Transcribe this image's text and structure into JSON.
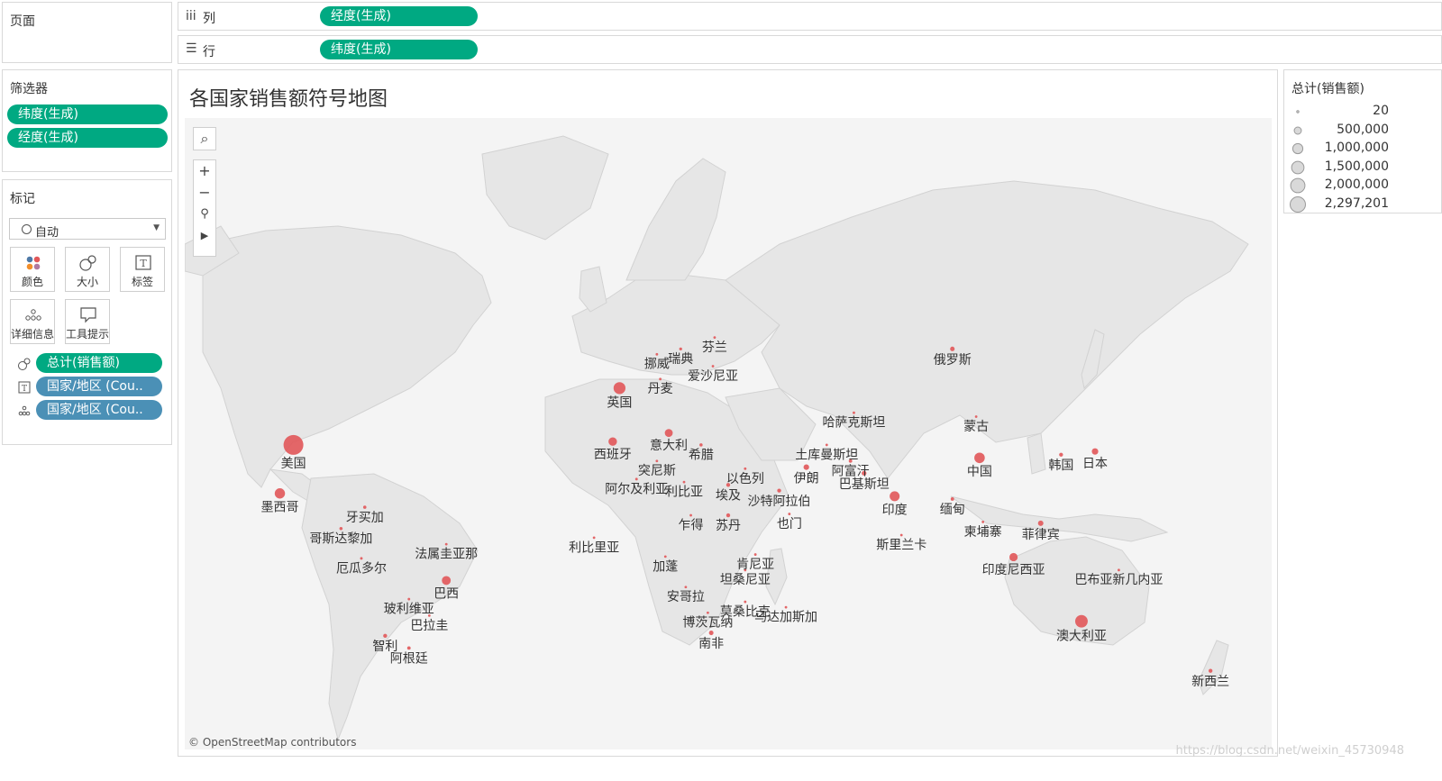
{
  "shelves": {
    "pages_label": "页面",
    "columns_icon": "iii",
    "columns_label": "列",
    "columns_pill": "经度(生成)",
    "rows_icon": "☰",
    "rows_label": "行",
    "rows_pill": "纬度(生成)"
  },
  "filters": {
    "title": "筛选器",
    "items": [
      "纬度(生成)",
      "经度(生成)"
    ]
  },
  "marks": {
    "title": "标记",
    "mark_type": "自动",
    "buttons": [
      "颜色",
      "大小",
      "标签",
      "详细信息",
      "工具提示"
    ],
    "fields": [
      "总计(销售额)",
      "国家/地区 (Cou..",
      "国家/地区 (Cou.."
    ]
  },
  "sheet": {
    "title": "各国家销售额符号地图"
  },
  "map": {
    "copyright": "© OpenStreetMap contributors",
    "marker_color": "#e15759",
    "land_color": "#e6e6e6",
    "water_color": "#f4f4f4"
  },
  "chart_data": {
    "type": "symbol-map",
    "title": "各国家销售额符号地图",
    "size_field": "总计(销售额)",
    "countries": [
      {
        "name": "美国",
        "lon": -98,
        "lat": 39,
        "size": 2297201
      },
      {
        "name": "墨西哥",
        "lon": -102,
        "lat": 23,
        "size": 620000
      },
      {
        "name": "牙买加",
        "lon": -77,
        "lat": 18,
        "size": 60000
      },
      {
        "name": "哥斯达黎加",
        "lon": -84,
        "lat": 10,
        "size": 60000
      },
      {
        "name": "法属圭亚那",
        "lon": -53,
        "lat": 4,
        "size": 20
      },
      {
        "name": "厄瓜多尔",
        "lon": -78,
        "lat": -1.5,
        "size": 40000
      },
      {
        "name": "巴西",
        "lon": -53,
        "lat": -10,
        "size": 460000
      },
      {
        "name": "玻利维亚",
        "lon": -64,
        "lat": -17,
        "size": 20000
      },
      {
        "name": "智利",
        "lon": -71,
        "lat": -30,
        "size": 90000
      },
      {
        "name": "巴拉圭",
        "lon": -58,
        "lat": -23,
        "size": 20000
      },
      {
        "name": "阿根廷",
        "lon": -64,
        "lat": -34,
        "size": 70000
      },
      {
        "name": "英国",
        "lon": -2,
        "lat": 54,
        "size": 830000
      },
      {
        "name": "丹麦",
        "lon": 10,
        "lat": 56,
        "size": 20000
      },
      {
        "name": "瑞典",
        "lon": 16,
        "lat": 62,
        "size": 50000
      },
      {
        "name": "挪威",
        "lon": 9,
        "lat": 61,
        "size": 30000
      },
      {
        "name": "芬兰",
        "lon": 26,
        "lat": 64,
        "size": 30000
      },
      {
        "name": "爱沙尼亚",
        "lon": 25.5,
        "lat": 58.7,
        "size": 20
      },
      {
        "name": "西班牙",
        "lon": -4,
        "lat": 40,
        "size": 420000
      },
      {
        "name": "意大利",
        "lon": 12.5,
        "lat": 42.5,
        "size": 370000
      },
      {
        "name": "希腊",
        "lon": 22,
        "lat": 39,
        "size": 60000
      },
      {
        "name": "突尼斯",
        "lon": 9,
        "lat": 34,
        "size": 20000
      },
      {
        "name": "阿尔及利亚",
        "lon": 3,
        "lat": 28,
        "size": 40000
      },
      {
        "name": "利比亚",
        "lon": 17,
        "lat": 27,
        "size": 20000
      },
      {
        "name": "埃及",
        "lon": 30,
        "lat": 26,
        "size": 90000
      },
      {
        "name": "以色列",
        "lon": 35,
        "lat": 31.5,
        "size": 40000
      },
      {
        "name": "沙特阿拉伯",
        "lon": 45,
        "lat": 24,
        "size": 90000
      },
      {
        "name": "土库曼斯坦",
        "lon": 59,
        "lat": 39,
        "size": 20000
      },
      {
        "name": "伊朗",
        "lon": 53,
        "lat": 32,
        "size": 180000
      },
      {
        "name": "阿富汗",
        "lon": 66,
        "lat": 34,
        "size": 70000
      },
      {
        "name": "巴基斯坦",
        "lon": 70,
        "lat": 30,
        "size": 130000
      },
      {
        "name": "哈萨克斯坦",
        "lon": 67,
        "lat": 48,
        "size": 40000
      },
      {
        "name": "俄罗斯",
        "lon": 96,
        "lat": 62,
        "size": 120000
      },
      {
        "name": "蒙古",
        "lon": 103,
        "lat": 47,
        "size": 20000
      },
      {
        "name": "中国",
        "lon": 104,
        "lat": 35,
        "size": 640000
      },
      {
        "name": "韩国",
        "lon": 128,
        "lat": 36,
        "size": 90000
      },
      {
        "name": "日本",
        "lon": 138,
        "lat": 37,
        "size": 240000
      },
      {
        "name": "印度",
        "lon": 79,
        "lat": 22,
        "size": 580000
      },
      {
        "name": "缅甸",
        "lon": 96,
        "lat": 21,
        "size": 70000
      },
      {
        "name": "斯里兰卡",
        "lon": 81,
        "lat": 7.5,
        "size": 20000
      },
      {
        "name": "柬埔寨",
        "lon": 105,
        "lat": 12.5,
        "size": 20000
      },
      {
        "name": "菲律宾",
        "lon": 122,
        "lat": 12,
        "size": 170000
      },
      {
        "name": "印度尼西亚",
        "lon": 114,
        "lat": -1,
        "size": 400000
      },
      {
        "name": "巴布亚新几内亚",
        "lon": 145,
        "lat": -6,
        "size": 30000
      },
      {
        "name": "澳大利亚",
        "lon": 134,
        "lat": -25,
        "size": 920000
      },
      {
        "name": "新西兰",
        "lon": 172,
        "lat": -41,
        "size": 90000
      },
      {
        "name": "利比里亚",
        "lon": -9.5,
        "lat": 6.5,
        "size": 20000
      },
      {
        "name": "乍得",
        "lon": 19,
        "lat": 15,
        "size": 20000
      },
      {
        "name": "苏丹",
        "lon": 30,
        "lat": 15,
        "size": 90000
      },
      {
        "name": "也门",
        "lon": 48,
        "lat": 15.5,
        "size": 30000
      },
      {
        "name": "加蓬",
        "lon": 11.5,
        "lat": -0.8,
        "size": 20000
      },
      {
        "name": "肯尼亚",
        "lon": 38,
        "lat": 0,
        "size": 30000
      },
      {
        "name": "坦桑尼亚",
        "lon": 35,
        "lat": -6,
        "size": 30000
      },
      {
        "name": "安哥拉",
        "lon": 17.5,
        "lat": -12.5,
        "size": 30000
      },
      {
        "name": "莫桑比克",
        "lon": 35,
        "lat": -18,
        "size": 30000
      },
      {
        "name": "马达加斯加",
        "lon": 47,
        "lat": -20,
        "size": 20000
      },
      {
        "name": "博茨瓦纳",
        "lon": 24,
        "lat": -22,
        "size": 20000
      },
      {
        "name": "南非",
        "lon": 25,
        "lat": -29,
        "size": 120000
      }
    ],
    "legend": {
      "title": "总计(销售额)",
      "values": [
        "20",
        "500,000",
        "1,000,000",
        "1,500,000",
        "2,000,000",
        "2,297,201"
      ]
    }
  }
}
